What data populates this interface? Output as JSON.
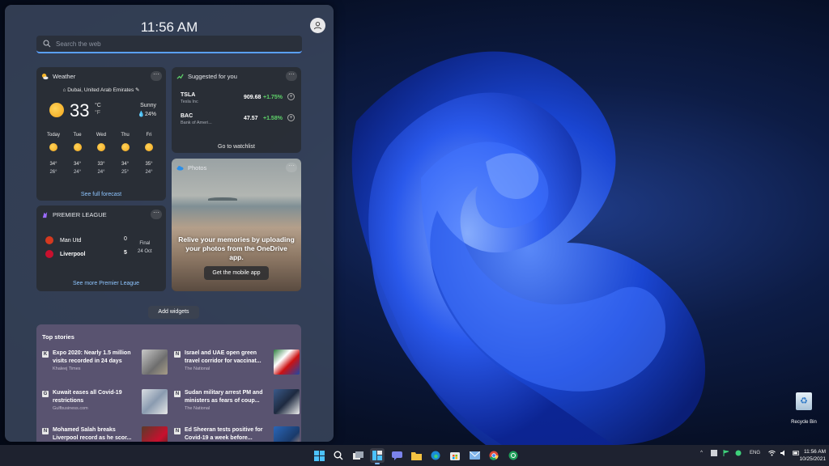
{
  "panel": {
    "time": "11:56 AM",
    "search_placeholder": "Search the web"
  },
  "weather": {
    "title": "Weather",
    "location": "Dubai, United Arab Emirates",
    "temperature": "33",
    "unit_c": "°C",
    "unit_f": "°F",
    "condition": "Sunny",
    "precip": "24%",
    "forecast": [
      {
        "day": "Today",
        "hi": "34°",
        "lo": "26°"
      },
      {
        "day": "Tue",
        "hi": "34°",
        "lo": "24°"
      },
      {
        "day": "Wed",
        "hi": "33°",
        "lo": "24°"
      },
      {
        "day": "Thu",
        "hi": "34°",
        "lo": "25°"
      },
      {
        "day": "Fri",
        "hi": "35°",
        "lo": "24°"
      }
    ],
    "link": "See full forecast"
  },
  "stocks": {
    "title": "Suggested for you",
    "items": [
      {
        "symbol": "TSLA",
        "name": "Tesla Inc",
        "price": "909.68",
        "change": "+1.75%"
      },
      {
        "symbol": "BAC",
        "name": "Bank of Ameri...",
        "price": "47.57",
        "change": "+1.58%"
      }
    ],
    "link": "Go to watchlist"
  },
  "photos": {
    "title": "Photos",
    "message": "Relive your memories by uploading your photos from the OneDrive app.",
    "button": "Get the mobile app"
  },
  "league": {
    "title": "PREMIER LEAGUE",
    "home": {
      "name": "Man Utd",
      "score": "0"
    },
    "away": {
      "name": "Liverpool",
      "score": "5"
    },
    "status": "Final",
    "date": "24 Oct",
    "link": "See more Premier League"
  },
  "add_widgets": "Add widgets",
  "stories": {
    "title": "Top stories",
    "items": [
      {
        "headline": "Expo 2020: Nearly 1.5 million visits recorded in 24 days",
        "source": "Khaleej Times",
        "icon": "K"
      },
      {
        "headline": "Israel and UAE open green travel corridor for vaccinat...",
        "source": "The National",
        "icon": "N"
      },
      {
        "headline": "Kuwait eases all Covid-19 restrictions",
        "source": "Gulfbusiness.com",
        "icon": "G"
      },
      {
        "headline": "Sudan military arrest PM and ministers as fears of coup...",
        "source": "The National",
        "icon": "N"
      },
      {
        "headline": "Mohamed Salah breaks Liverpool record as he scor...",
        "source": "",
        "icon": "N"
      },
      {
        "headline": "Ed Sheeran tests positive for Covid-19 a week before...",
        "source": "",
        "icon": "N"
      }
    ]
  },
  "desktop": {
    "recycle_bin": "Recycle Bin"
  },
  "taskbar": {
    "lang": "ENG",
    "time": "11:56 AM",
    "date": "10/25/2021",
    "icons": [
      "windows-start-icon",
      "search-icon",
      "task-view-icon",
      "widgets-icon",
      "chat-icon",
      "file-explorer-icon",
      "edge-icon",
      "store-icon",
      "mail-icon",
      "chrome-icon",
      "browser-icon"
    ]
  },
  "colors": {
    "accent": "#5aa0ff",
    "positive": "#5fd36a",
    "link": "#8ec5ff"
  }
}
